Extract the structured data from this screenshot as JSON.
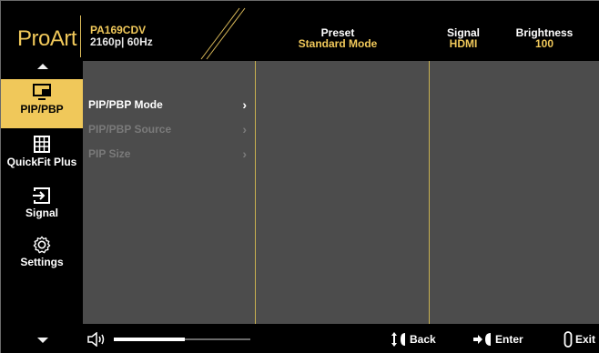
{
  "header": {
    "logo": "ProArt",
    "model": "PA169CDV",
    "resolution": "2160p| 60Hz",
    "preset_label": "Preset",
    "preset_value": "Standard Mode",
    "signal_label": "Signal",
    "signal_value": "HDMI",
    "brightness_label": "Brightness",
    "brightness_value": "100"
  },
  "sidebar": {
    "items": [
      {
        "label": "PIP/PBP",
        "icon": "monitor-icon",
        "active": true
      },
      {
        "label": "QuickFit Plus",
        "icon": "grid-icon",
        "active": false
      },
      {
        "label": "Signal",
        "icon": "input-icon",
        "active": false
      },
      {
        "label": "Settings",
        "icon": "gear-icon",
        "active": false
      }
    ]
  },
  "menu": {
    "items": [
      {
        "label": "PIP/PBP Mode",
        "enabled": true
      },
      {
        "label": "PIP/PBP Source",
        "enabled": false
      },
      {
        "label": "PIP Size",
        "enabled": false
      }
    ]
  },
  "bottom": {
    "volume_level": 0.52,
    "back_label": "Back",
    "enter_label": "Enter",
    "exit_label": "Exit"
  },
  "colors": {
    "accent": "#f0c85a",
    "background": "#4c4c4c",
    "bar": "#000000"
  }
}
